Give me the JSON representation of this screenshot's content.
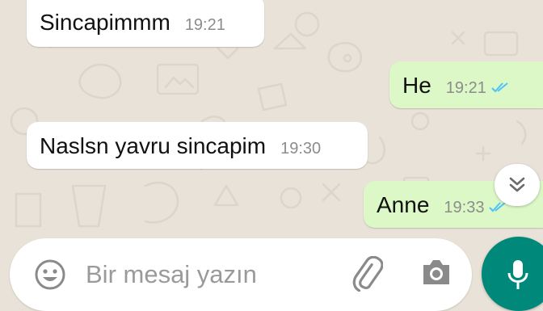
{
  "messages": [
    {
      "direction": "incoming",
      "text": "Sincapimmm",
      "time": "19:21"
    },
    {
      "direction": "outgoing",
      "text": "He",
      "time": "19:21",
      "status": "read"
    },
    {
      "direction": "incoming",
      "text": "Naslsn yavru sincapim",
      "time": "19:30"
    },
    {
      "direction": "outgoing",
      "text": "Anne",
      "time": "19:33",
      "status": "read"
    }
  ],
  "composer": {
    "placeholder": "Bir mesaj yazın",
    "icons": [
      "emoji-icon",
      "attach-icon",
      "camera-icon",
      "mic-icon"
    ]
  },
  "scroll_button_icon": "double-chevron-down-icon",
  "colors": {
    "chat_background": "#e9e2d8",
    "incoming_bubble": "#ffffff",
    "outgoing_bubble": "#dcf8c6",
    "read_ticks": "#4fc3f7",
    "accent": "#00897b",
    "timestamp": "#8c8c8c"
  }
}
